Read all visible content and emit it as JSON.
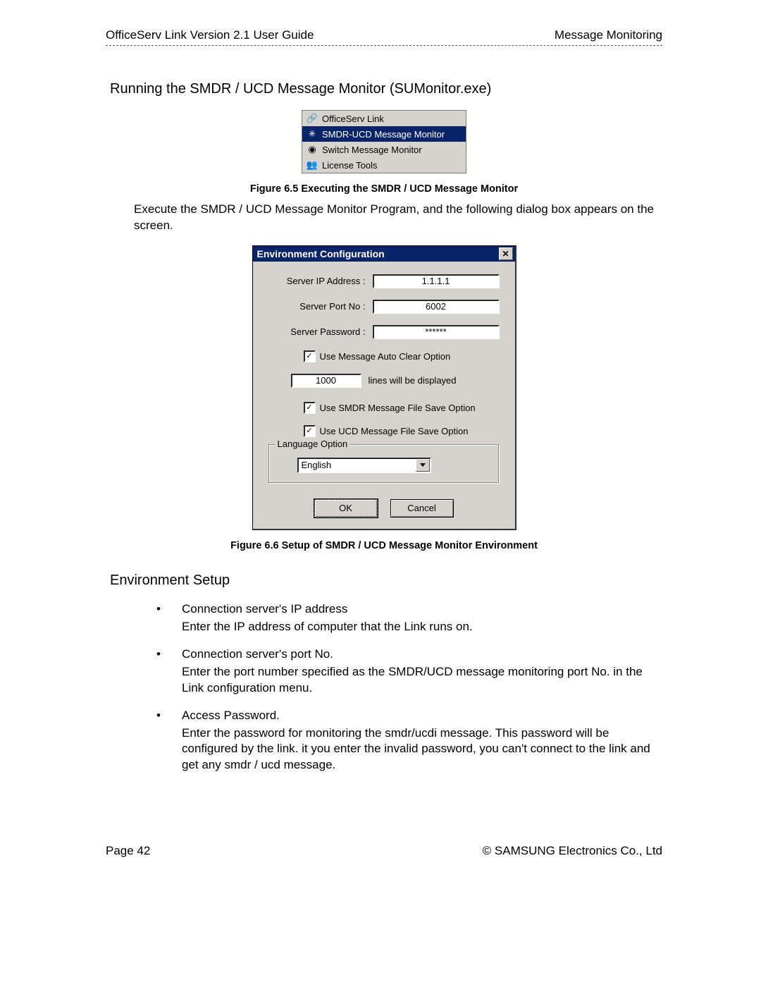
{
  "header": {
    "left": "OfficeServ Link Version 2.1 User Guide",
    "right": "Message Monitoring"
  },
  "section1_title": "Running the SMDR / UCD Message Monitor (SUMonitor.exe)",
  "startmenu": {
    "items": [
      {
        "label": "OfficeServ Link",
        "selected": false,
        "icon": "🔗"
      },
      {
        "label": "SMDR-UCD Message Monitor",
        "selected": true,
        "icon": "✳"
      },
      {
        "label": "Switch Message Monitor",
        "selected": false,
        "icon": "◉"
      },
      {
        "label": "License Tools",
        "selected": false,
        "icon": "👥"
      }
    ]
  },
  "caption_6_5": "Figure 6.5 Executing the SMDR / UCD Message Monitor",
  "para_after_6_5": "Execute the SMDR / UCD Message Monitor Program, and the following dialog box appears on the screen.",
  "dialog": {
    "title": "Environment Configuration",
    "ip_label": "Server IP Address :",
    "ip_value": "1.1.1.1",
    "port_label": "Server Port No :",
    "port_value": "6002",
    "pwd_label": "Server Password :",
    "pwd_value": "******",
    "chk_autoclear": "Use Message Auto Clear Option",
    "lines_value": "1000",
    "lines_suffix": "lines will be displayed",
    "chk_smdr_save": "Use SMDR Message File Save Option",
    "chk_ucd_save": "Use UCD Message File Save Option",
    "lang_legend": "Language Option",
    "lang_value": "English",
    "ok": "OK",
    "cancel": "Cancel"
  },
  "caption_6_6": "Figure 6.6 Setup of SMDR / UCD Message Monitor Environment",
  "section2_title": "Environment Setup",
  "bullets": [
    {
      "head": "Connection server's IP address",
      "body": "Enter the IP address of computer that the Link runs on."
    },
    {
      "head": "Connection server's port No.",
      "body": "Enter the port number specified as the SMDR/UCD message monitoring port No. in the Link configuration menu."
    },
    {
      "head": "Access Password.",
      "body": "Enter the password for monitoring the smdr/ucdi message. This password will be configured by the link. it you enter the invalid password, you can't connect to the link and get any smdr / ucd message."
    }
  ],
  "footer": {
    "left": "Page 42",
    "right": "© SAMSUNG Electronics Co., Ltd"
  }
}
